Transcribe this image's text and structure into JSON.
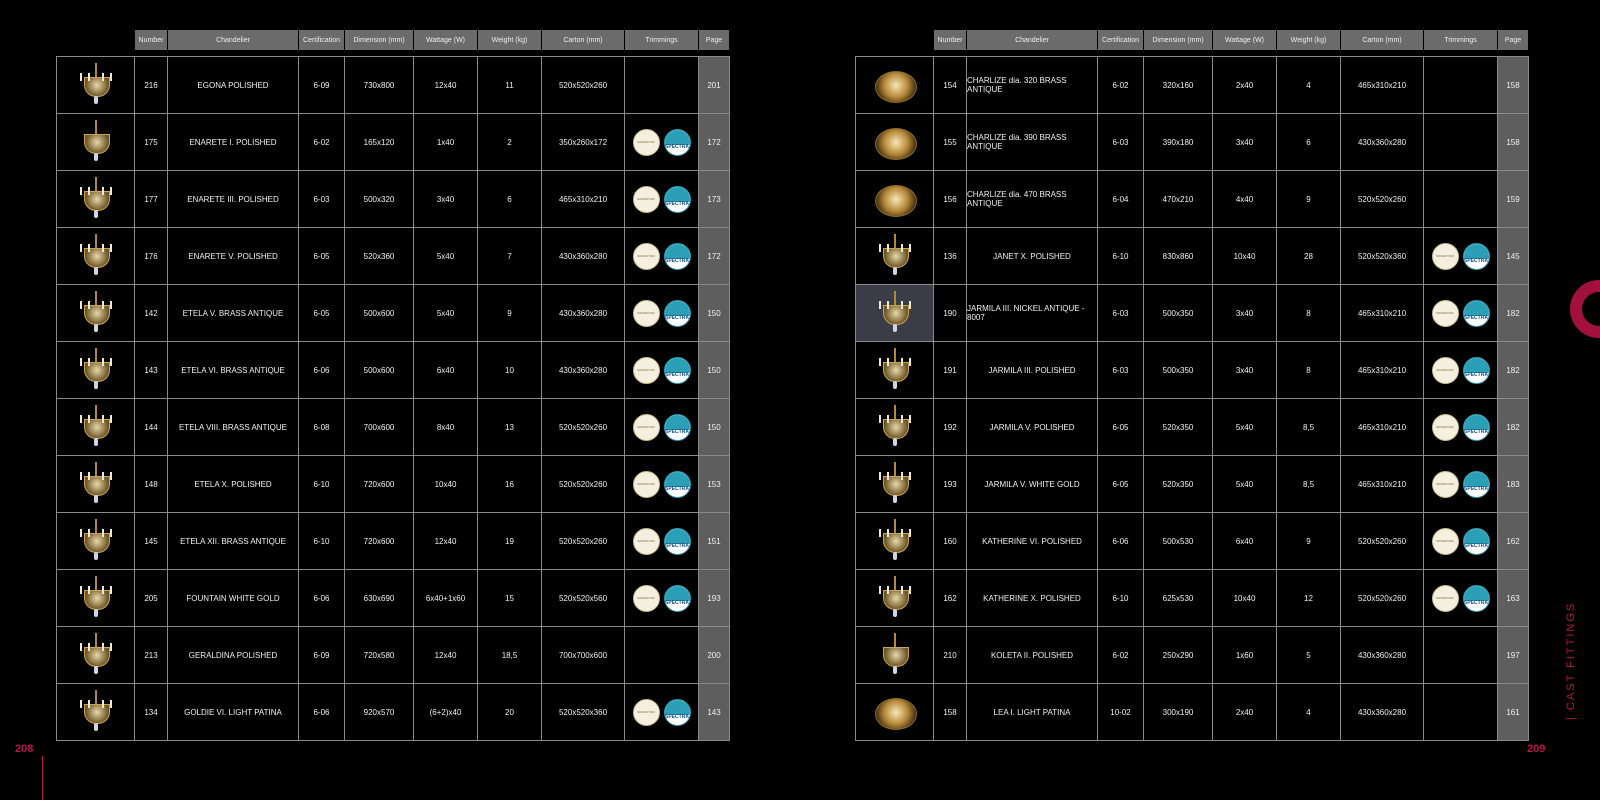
{
  "headers": [
    "Number",
    "Chandelier",
    "Certification",
    "Dimension (mm)",
    "Wattage (W)",
    "Weight (kg)",
    "Carton (mm)",
    "Trimmings",
    "Page"
  ],
  "badge_labels": {
    "cream": "SWAROVSKI",
    "spectra": "SPECTRA"
  },
  "left_rows": [
    {
      "number": "216",
      "name": "EGONA POLISHED",
      "cert": "6-09",
      "dim": "730x800",
      "watt": "12x40",
      "weight": "11",
      "carton": "520x520x260",
      "trimmings": false,
      "page": "201",
      "thumb": "chandelier"
    },
    {
      "number": "175",
      "name": "ENARETE I. POLISHED",
      "cert": "6-02",
      "dim": "165x120",
      "watt": "1x40",
      "weight": "2",
      "carton": "350x260x172",
      "trimmings": true,
      "page": "172",
      "thumb": "pendant"
    },
    {
      "number": "177",
      "name": "ENARETE III. POLISHED",
      "cert": "6-03",
      "dim": "500x320",
      "watt": "3x40",
      "weight": "6",
      "carton": "465x310x210",
      "trimmings": true,
      "page": "173",
      "thumb": "chandelier"
    },
    {
      "number": "176",
      "name": "ENARETE V. POLISHED",
      "cert": "6-05",
      "dim": "520x360",
      "watt": "5x40",
      "weight": "7",
      "carton": "430x360x280",
      "trimmings": true,
      "page": "172",
      "thumb": "chandelier"
    },
    {
      "number": "142",
      "name": "ETELA V. BRASS ANTIQUE",
      "cert": "6-05",
      "dim": "500x600",
      "watt": "5x40",
      "weight": "9",
      "carton": "430x360x280",
      "trimmings": true,
      "page": "150",
      "thumb": "chandelier"
    },
    {
      "number": "143",
      "name": "ETELA VI. BRASS ANTIQUE",
      "cert": "6-06",
      "dim": "500x600",
      "watt": "6x40",
      "weight": "10",
      "carton": "430x360x280",
      "trimmings": true,
      "page": "150",
      "thumb": "chandelier"
    },
    {
      "number": "144",
      "name": "ETELA VIII. BRASS ANTIQUE",
      "cert": "6-08",
      "dim": "700x600",
      "watt": "8x40",
      "weight": "13",
      "carton": "520x520x260",
      "trimmings": true,
      "page": "150",
      "thumb": "chandelier"
    },
    {
      "number": "148",
      "name": "ETELA X. POLISHED",
      "cert": "6-10",
      "dim": "720x600",
      "watt": "10x40",
      "weight": "16",
      "carton": "520x520x260",
      "trimmings": true,
      "page": "153",
      "thumb": "chandelier"
    },
    {
      "number": "145",
      "name": "ETELA XII. BRASS ANTIQUE",
      "cert": "6-10",
      "dim": "720x600",
      "watt": "12x40",
      "weight": "19",
      "carton": "520x520x260",
      "trimmings": true,
      "page": "151",
      "thumb": "chandelier"
    },
    {
      "number": "205",
      "name": "FOUNTAIN WHITE GOLD",
      "cert": "6-06",
      "dim": "630x690",
      "watt": "6x40+1x60",
      "weight": "15",
      "carton": "520x520x560",
      "trimmings": true,
      "page": "193",
      "thumb": "chandelier"
    },
    {
      "number": "213",
      "name": "GERALDINA POLISHED",
      "cert": "6-09",
      "dim": "720x580",
      "watt": "12x40",
      "weight": "18,5",
      "carton": "700x700x600",
      "trimmings": false,
      "page": "200",
      "thumb": "chandelier"
    },
    {
      "number": "134",
      "name": "GOLDIE VI. LIGHT PATINA",
      "cert": "6-06",
      "dim": "920x570",
      "watt": "(6+2)x40",
      "weight": "20",
      "carton": "520x520x360",
      "trimmings": true,
      "page": "143",
      "thumb": "chandelier"
    }
  ],
  "right_rows": [
    {
      "number": "154",
      "name": "CHARLIZE dia. 320 BRASS ANTIQUE",
      "cert": "6-02",
      "dim": "320x160",
      "watt": "2x40",
      "weight": "4",
      "carton": "465x310x210",
      "trimmings": false,
      "page": "158",
      "thumb": "bowl"
    },
    {
      "number": "155",
      "name": "CHARLIZE dia. 390 BRASS ANTIQUE",
      "cert": "6-03",
      "dim": "390x180",
      "watt": "3x40",
      "weight": "6",
      "carton": "430x360x280",
      "trimmings": false,
      "page": "158",
      "thumb": "bowl"
    },
    {
      "number": "156",
      "name": "CHARLIZE dia. 470 BRASS ANTIQUE",
      "cert": "6-04",
      "dim": "470x210",
      "watt": "4x40",
      "weight": "9",
      "carton": "520x520x260",
      "trimmings": false,
      "page": "159",
      "thumb": "bowl"
    },
    {
      "number": "136",
      "name": "JANET X. POLISHED",
      "cert": "6-10",
      "dim": "830x860",
      "watt": "10x40",
      "weight": "28",
      "carton": "520x520x360",
      "trimmings": true,
      "page": "145",
      "thumb": "chandelier"
    },
    {
      "number": "190",
      "name": "JARMILA III. NICKEL ANTIQUE - 8007",
      "cert": "6-03",
      "dim": "500x350",
      "watt": "3x40",
      "weight": "8",
      "carton": "465x310x210",
      "trimmings": true,
      "page": "182",
      "thumb": "chandelier",
      "highlight": true
    },
    {
      "number": "191",
      "name": "JARMILA III. POLISHED",
      "cert": "6-03",
      "dim": "500x350",
      "watt": "3x40",
      "weight": "8",
      "carton": "465x310x210",
      "trimmings": true,
      "page": "182",
      "thumb": "chandelier"
    },
    {
      "number": "192",
      "name": "JARMILA V. POLISHED",
      "cert": "6-05",
      "dim": "520x350",
      "watt": "5x40",
      "weight": "8,5",
      "carton": "465x310x210",
      "trimmings": true,
      "page": "182",
      "thumb": "chandelier"
    },
    {
      "number": "193",
      "name": "JARMILA V. WHITE GOLD",
      "cert": "6-05",
      "dim": "520x350",
      "watt": "5x40",
      "weight": "8,5",
      "carton": "465x310x210",
      "trimmings": true,
      "page": "183",
      "thumb": "chandelier"
    },
    {
      "number": "160",
      "name": "KATHERINE VI. POLISHED",
      "cert": "6-06",
      "dim": "500x530",
      "watt": "6x40",
      "weight": "9",
      "carton": "520x520x260",
      "trimmings": true,
      "page": "162",
      "thumb": "chandelier"
    },
    {
      "number": "162",
      "name": "KATHERINE X. POLISHED",
      "cert": "6-10",
      "dim": "625x530",
      "watt": "10x40",
      "weight": "12",
      "carton": "520x520x260",
      "trimmings": true,
      "page": "163",
      "thumb": "chandelier"
    },
    {
      "number": "210",
      "name": "KOLETA II. POLISHED",
      "cert": "6-02",
      "dim": "250x290",
      "watt": "1x60",
      "weight": "5",
      "carton": "430x360x280",
      "trimmings": false,
      "page": "197",
      "thumb": "lantern"
    },
    {
      "number": "158",
      "name": "LEA I. LIGHT PATINA",
      "cert": "10-02",
      "dim": "300x190",
      "watt": "2x40",
      "weight": "4",
      "carton": "430x360x280",
      "trimmings": false,
      "page": "161",
      "thumb": "bowl"
    }
  ],
  "footer": {
    "page_left": "208",
    "page_right": "209",
    "section_title": "| CAST FITTINGS"
  },
  "colors": {
    "accent": "#b8154e",
    "header_bg": "#6b6b6b",
    "grid": "#8a8a8a"
  }
}
